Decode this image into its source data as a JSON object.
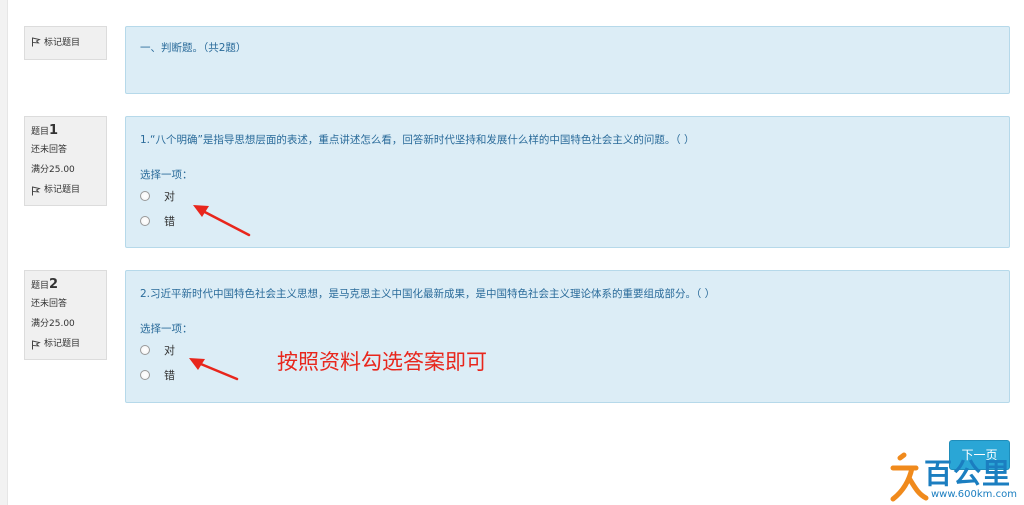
{
  "section": {
    "flag_label": "标记题目",
    "title": "一、判断题。（共2题）"
  },
  "questions": [
    {
      "no_prefix": "题目",
      "no": "1",
      "status": "还未回答",
      "score": "满分25.00",
      "flag_label": "标记题目",
      "text": "1.“八个明确”是指导思想层面的表述，重点讲述怎么看，回答新时代坚持和发展什么样的中国特色社会主义的问题。（  ）",
      "prompt": "选择一项：",
      "options": [
        "对",
        "错"
      ]
    },
    {
      "no_prefix": "题目",
      "no": "2",
      "status": "还未回答",
      "score": "满分25.00",
      "flag_label": "标记题目",
      "text": "2.习近平新时代中国特色社会主义思想，是马克思主义中国化最新成果，是中国特色社会主义理论体系的重要组成部分。（  ）",
      "prompt": "选择一项：",
      "options": [
        "对",
        "错"
      ]
    }
  ],
  "annotation": "按照资料勾选答案即可",
  "next_button": "下一页",
  "watermark": {
    "text": "百公里",
    "url": "www.600km.com"
  }
}
